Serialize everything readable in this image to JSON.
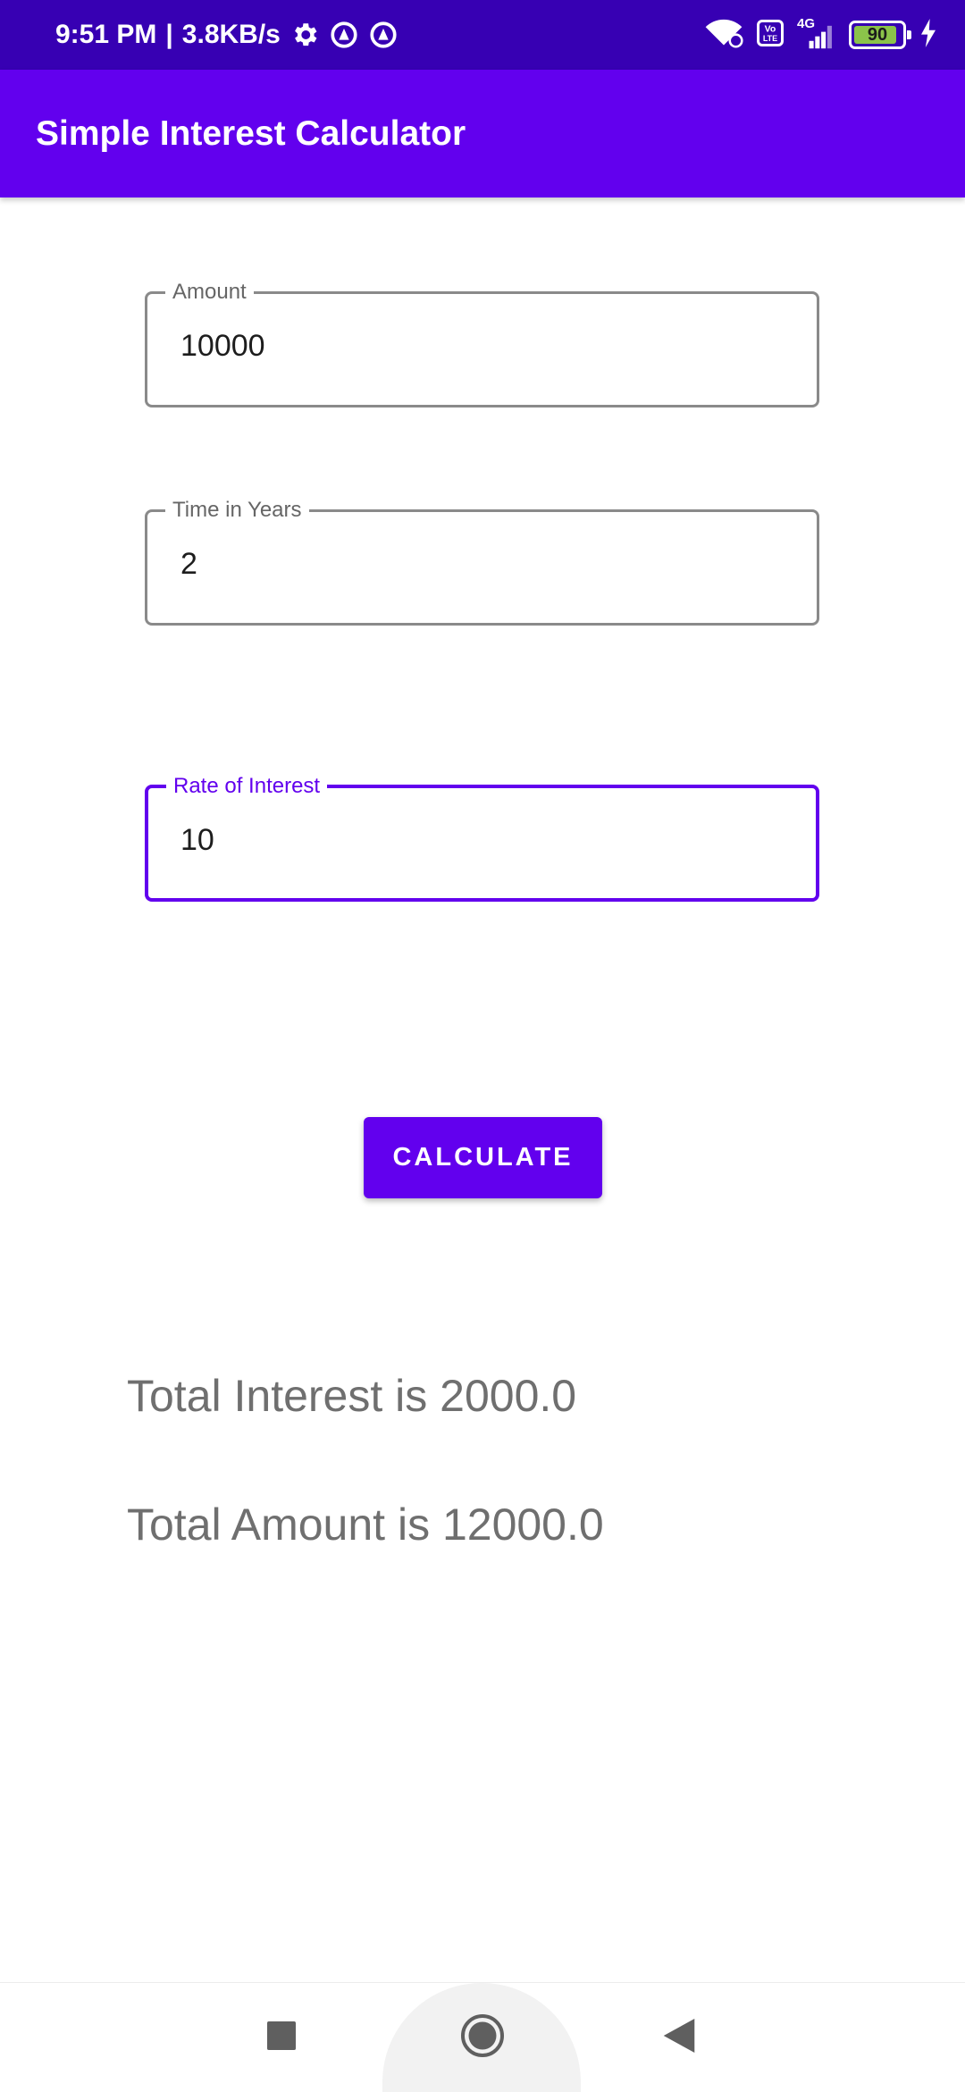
{
  "status_bar": {
    "time": "9:51 PM",
    "speed": "3.8KB/s",
    "network": "4G",
    "battery": "90",
    "battery_level": 0.9,
    "icons": [
      "settings-icon",
      "data-saver-icon",
      "data-saver-icon",
      "wifi-icon",
      "volte-icon",
      "signal-icon",
      "battery-icon",
      "charging-icon"
    ]
  },
  "app_bar": {
    "title": "Simple Interest Calculator"
  },
  "form": {
    "amount": {
      "label": "Amount",
      "value": "10000"
    },
    "time": {
      "label": "Time in Years",
      "value": "2"
    },
    "rate": {
      "label": "Rate of Interest",
      "value": "10"
    }
  },
  "calculate_label": "CALCULATE",
  "results": {
    "interest": "Total Interest is 2000.0",
    "amount": "Total Amount is 12000.0"
  },
  "nav": {
    "icons": [
      "recents-icon",
      "home-icon",
      "back-icon"
    ]
  },
  "colors": {
    "status_bar": "#3700b3",
    "primary": "#6200ee",
    "result_text": "#6f6f6f",
    "battery": "#8bc34a"
  }
}
